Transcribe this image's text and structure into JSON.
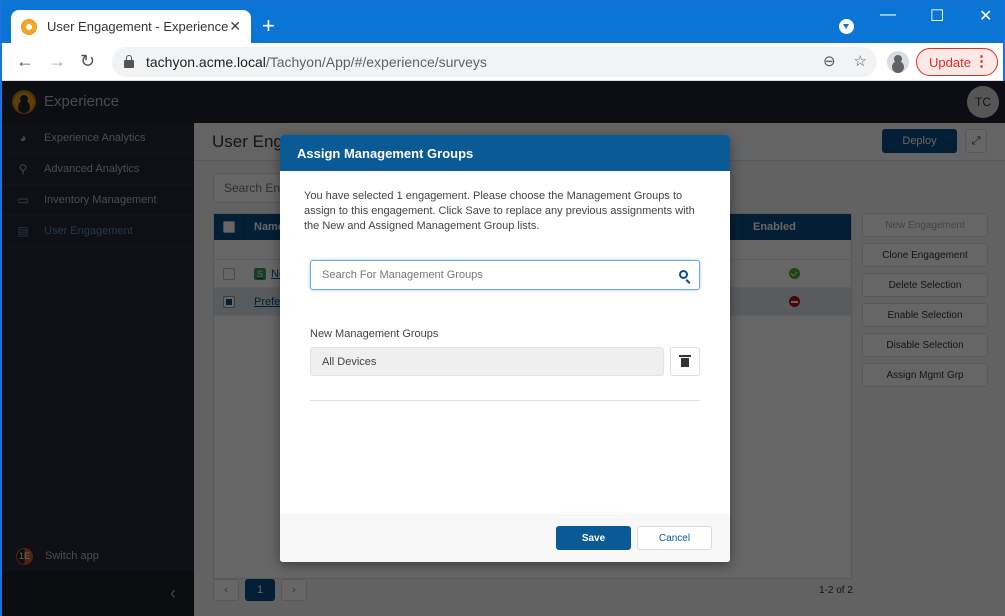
{
  "browser": {
    "tab_title": "User Engagement - Experience",
    "new_tab_label": "+",
    "url_host": "tachyon.acme.local",
    "url_path": "/Tachyon/App/#/experience/surveys",
    "update_label": "Update",
    "window_controls": [
      "minimize",
      "maximize",
      "close"
    ]
  },
  "app": {
    "name": "Experience",
    "user_initials": "TC"
  },
  "sidebar": {
    "items": [
      {
        "label": "Experience Analytics",
        "icon": "dashboard-icon"
      },
      {
        "label": "Advanced Analytics",
        "icon": "binoculars-icon"
      },
      {
        "label": "Inventory Management",
        "icon": "monitor-icon"
      },
      {
        "label": "User Engagement",
        "icon": "clipboard-icon",
        "active": true
      }
    ],
    "switch_app_label": "Switch app"
  },
  "main": {
    "page_title": "User Engagement",
    "deploy_label": "Deploy",
    "search_placeholder": "Search Engagements",
    "table": {
      "columns": [
        "Name",
        "Enabled"
      ],
      "rows": [
        {
          "name": "Net",
          "badge": "S",
          "checked": false,
          "enabled": true
        },
        {
          "name": "Preferre",
          "badge": "",
          "checked": true,
          "enabled": false
        }
      ]
    },
    "actions": [
      {
        "label": "New Engagement",
        "disabled": true
      },
      {
        "label": "Clone Engagement",
        "disabled": false
      },
      {
        "label": "Delete Selection",
        "disabled": false
      },
      {
        "label": "Enable Selection",
        "disabled": false
      },
      {
        "label": "Disable Selection",
        "disabled": false
      },
      {
        "label": "Assign Mgmt Grp",
        "disabled": false
      }
    ],
    "pager": {
      "prev": "‹",
      "current": "1",
      "next": "›",
      "info": "1-2 of 2"
    }
  },
  "modal": {
    "title": "Assign Management Groups",
    "description": "You have selected 1 engagement. Please choose the Management Groups to assign to this engagement. Click Save to replace any previous assignments with the New and Assigned Management Group lists.",
    "search_placeholder": "Search For Management Groups",
    "search_value": "",
    "new_groups_label": "New Management Groups",
    "new_groups": [
      "All Devices"
    ],
    "save_label": "Save",
    "cancel_label": "Cancel"
  },
  "colors": {
    "brand": "#0a5a96",
    "app_bar": "#1e2330",
    "sidebar": "#232936",
    "status_ok": "#4caf2f",
    "status_disabled": "#b01515",
    "chrome_update": "#d93025"
  }
}
